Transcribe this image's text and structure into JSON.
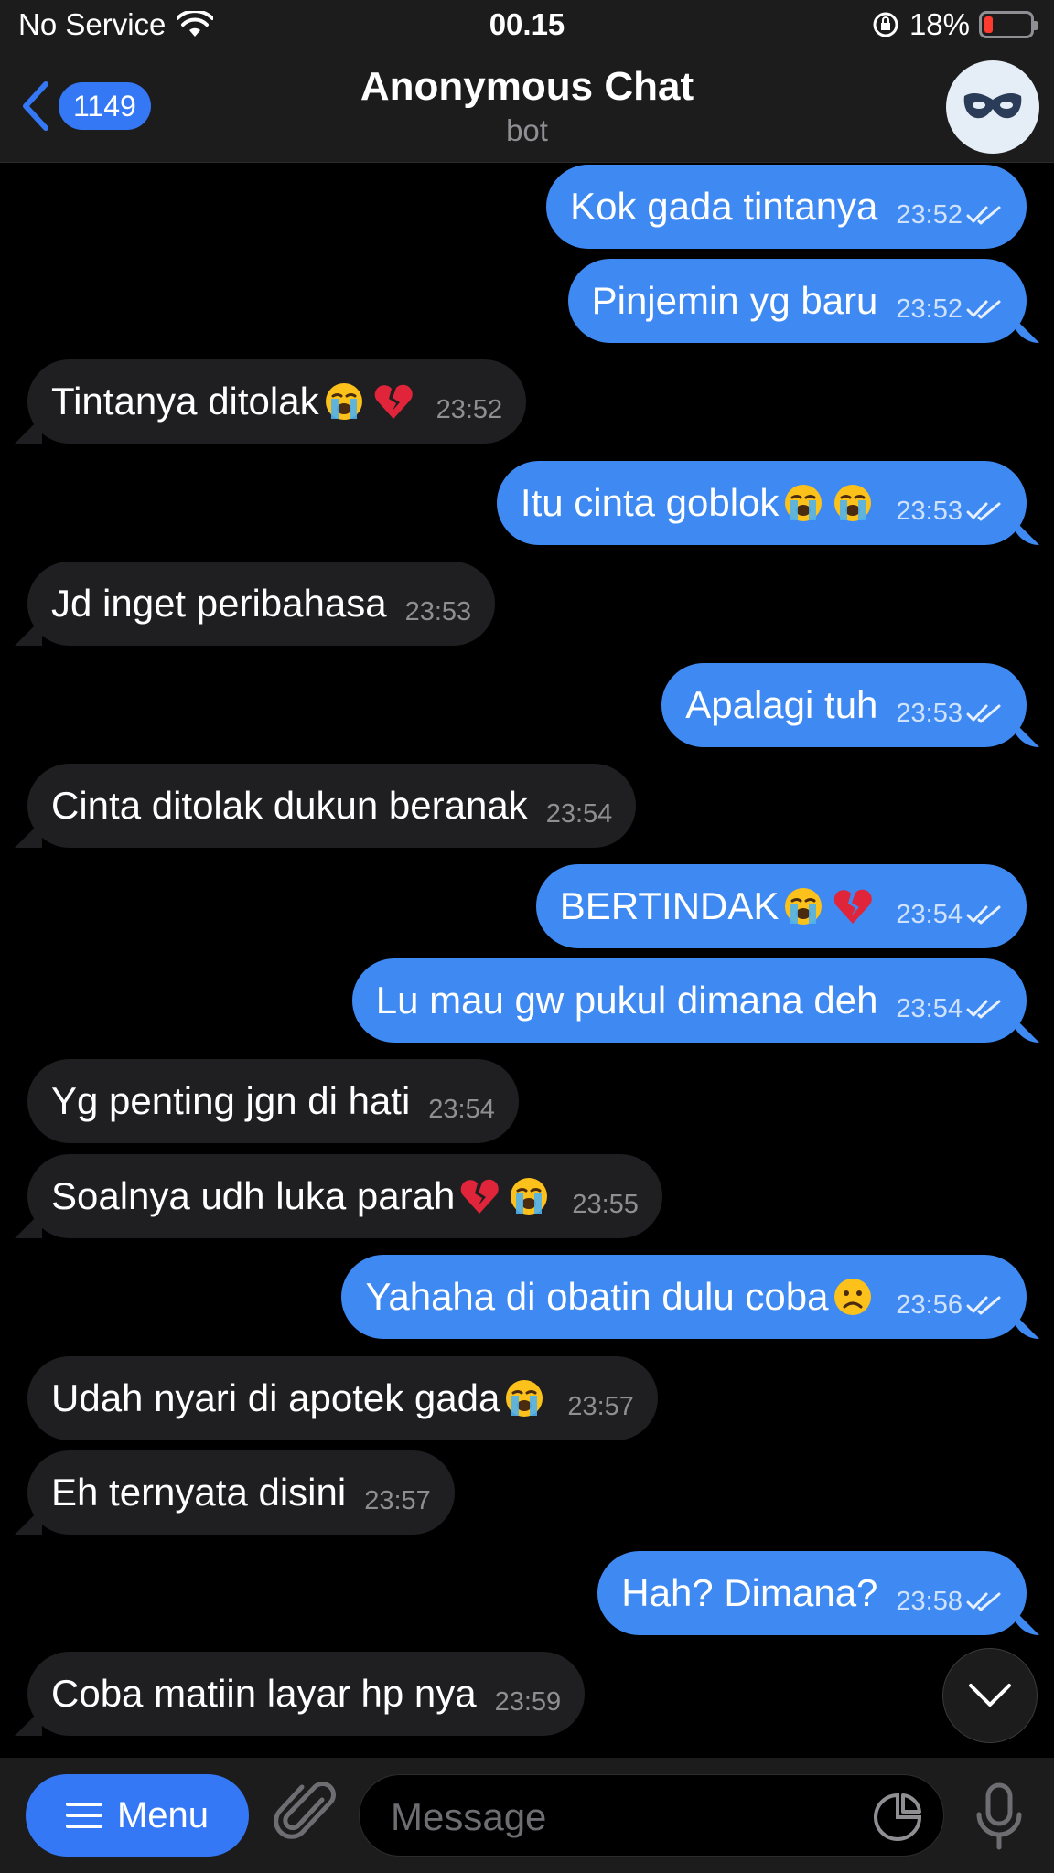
{
  "status_bar": {
    "carrier": "No Service",
    "time": "00.15",
    "battery": "18%",
    "battery_level": 0.18,
    "icons": [
      "wifi-icon",
      "rotation-lock-icon",
      "battery-icon"
    ]
  },
  "header": {
    "back_count": "1149",
    "title": "Anonymous Chat",
    "subtitle": "bot",
    "avatar_icon": "mask-icon"
  },
  "colors": {
    "outgoing_bubble": "#3e89f2",
    "incoming_bubble": "#1f1f21",
    "accent": "#3478f6",
    "background": "#000000"
  },
  "messages": [
    {
      "dir": "out",
      "text": "Kok gada tintanya",
      "time": "23:52",
      "read": true
    },
    {
      "dir": "out",
      "text": "Pinjemin yg baru",
      "time": "23:52",
      "read": true
    },
    {
      "dir": "in",
      "text": "Tintanya ditolak ",
      "emoji": [
        "crying-face",
        "broken-heart"
      ],
      "time": "23:52"
    },
    {
      "dir": "out",
      "text": "Itu cinta  goblok ",
      "emoji": [
        "crying-face",
        "crying-face"
      ],
      "time": "23:53",
      "read": true
    },
    {
      "dir": "in",
      "text": "Jd inget peribahasa",
      "time": "23:53"
    },
    {
      "dir": "out",
      "text": "Apalagi tuh",
      "time": "23:53",
      "read": true
    },
    {
      "dir": "in",
      "text": "Cinta ditolak dukun beranak",
      "time": "23:54"
    },
    {
      "dir": "out",
      "text": "BERTINDAK",
      "emoji": [
        "crying-face",
        "broken-heart"
      ],
      "time": "23:54",
      "read": true
    },
    {
      "dir": "out",
      "text": "Lu mau gw pukul dimana deh",
      "time": "23:54",
      "read": true
    },
    {
      "dir": "in",
      "text": "Yg penting jgn di hati",
      "time": "23:54"
    },
    {
      "dir": "in",
      "text": "Soalnya udh luka parah",
      "emoji": [
        "broken-heart",
        "crying-face"
      ],
      "time": "23:55"
    },
    {
      "dir": "out",
      "text": "Yahaha di obatin dulu coba",
      "emoji": [
        "frowning-face"
      ],
      "time": "23:56",
      "read": true
    },
    {
      "dir": "in",
      "text": "Udah nyari di apotek gada",
      "emoji": [
        "crying-face"
      ],
      "time": "23:57"
    },
    {
      "dir": "in",
      "text": "Eh ternyata disini",
      "time": "23:57"
    },
    {
      "dir": "out",
      "text": "Hah? Dimana?",
      "time": "23:58",
      "read": true
    },
    {
      "dir": "in",
      "text": "Coba matiin layar hp nya",
      "time": "23:59"
    }
  ],
  "input_bar": {
    "menu_label": "Menu",
    "placeholder": "Message",
    "icons": [
      "hamburger-icon",
      "paperclip-icon",
      "sticker-icon",
      "microphone-icon"
    ]
  }
}
